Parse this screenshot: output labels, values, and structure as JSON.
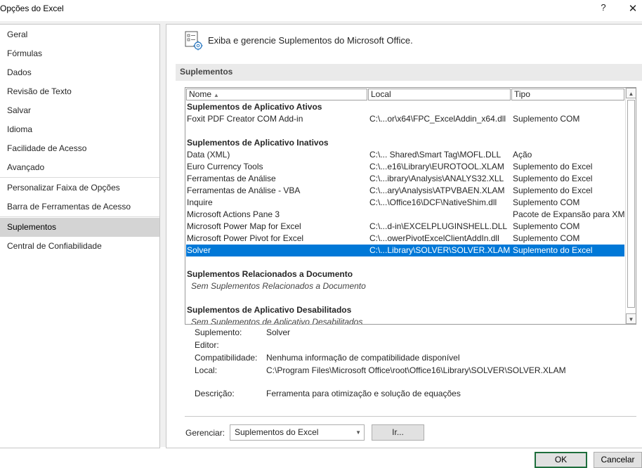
{
  "window": {
    "title": "Opções do Excel",
    "help": "?",
    "close": "✕"
  },
  "sidebar": {
    "items": [
      {
        "label": "Geral"
      },
      {
        "label": "Fórmulas"
      },
      {
        "label": "Dados"
      },
      {
        "label": "Revisão de Texto"
      },
      {
        "label": "Salvar"
      },
      {
        "label": "Idioma"
      },
      {
        "label": "Facilidade de Acesso"
      },
      {
        "label": "Avançado"
      },
      {
        "label": "Personalizar Faixa de Opções"
      },
      {
        "label": "Barra de Ferramentas de Acesso Rápido"
      },
      {
        "label": "Suplementos"
      },
      {
        "label": "Central de Confiabilidade"
      }
    ],
    "selected": "Suplementos"
  },
  "main": {
    "header": "Exiba e gerencie Suplementos do Microsoft Office.",
    "section_title": "Suplementos",
    "columns": {
      "name": "Nome",
      "location": "Local",
      "type": "Tipo"
    },
    "groups": {
      "active": {
        "title": "Suplementos de Aplicativo Ativos",
        "rows": [
          {
            "name": "Foxit PDF Creator COM Add-in",
            "location": "C:\\...or\\x64\\FPC_ExcelAddin_x64.dll",
            "type": "Suplemento COM"
          }
        ]
      },
      "inactive": {
        "title": "Suplementos de Aplicativo Inativos",
        "rows": [
          {
            "name": "Data (XML)",
            "location": "C:\\... Shared\\Smart Tag\\MOFL.DLL",
            "type": "Ação"
          },
          {
            "name": "Euro Currency Tools",
            "location": "C:\\...e16\\Library\\EUROTOOL.XLAM",
            "type": "Suplemento do Excel"
          },
          {
            "name": "Ferramentas de Análise",
            "location": "C:\\...ibrary\\Analysis\\ANALYS32.XLL",
            "type": "Suplemento do Excel"
          },
          {
            "name": "Ferramentas de Análise - VBA",
            "location": "C:\\...ary\\Analysis\\ATPVBAEN.XLAM",
            "type": "Suplemento do Excel"
          },
          {
            "name": "Inquire",
            "location": "C:\\...\\Office16\\DCF\\NativeShim.dll",
            "type": "Suplemento COM"
          },
          {
            "name": "Microsoft Actions Pane 3",
            "location": "",
            "type": "Pacote de Expansão para XML"
          },
          {
            "name": "Microsoft Power Map for Excel",
            "location": "C:\\...d-in\\EXCELPLUGINSHELL.DLL",
            "type": "Suplemento COM"
          },
          {
            "name": "Microsoft Power Pivot for Excel",
            "location": "C:\\...owerPivotExcelClientAddIn.dll",
            "type": "Suplemento COM"
          },
          {
            "name": "Solver",
            "location": "C:\\...Library\\SOLVER\\SOLVER.XLAM",
            "type": "Suplemento do Excel"
          }
        ]
      },
      "document": {
        "title": "Suplementos Relacionados a Documento",
        "empty": "Sem Suplementos Relacionados a Documento"
      },
      "disabled": {
        "title": "Suplementos de Aplicativo Desabilitados",
        "empty": "Sem Suplementos de Aplicativo Desabilitados"
      }
    },
    "details": {
      "addin_label": "Suplemento:",
      "addin_value": "Solver",
      "publisher_label": "Editor:",
      "publisher_value": "",
      "compat_label": "Compatibilidade:",
      "compat_value": "Nenhuma informação de compatibilidade disponível",
      "location_label": "Local:",
      "location_value": "C:\\Program Files\\Microsoft Office\\root\\Office16\\Library\\SOLVER\\SOLVER.XLAM",
      "desc_label": "Descrição:",
      "desc_value": "Ferramenta para otimização e solução de equações"
    },
    "manage": {
      "label": "Gerenciar:",
      "selected": "Suplementos do Excel",
      "go": "Ir..."
    }
  },
  "footer": {
    "ok": "OK",
    "cancel": "Cancelar"
  },
  "colors": {
    "selection": "#0078d7",
    "ok_border": "#1e6e3c",
    "sidebar_selected": "#d4d4d4"
  }
}
